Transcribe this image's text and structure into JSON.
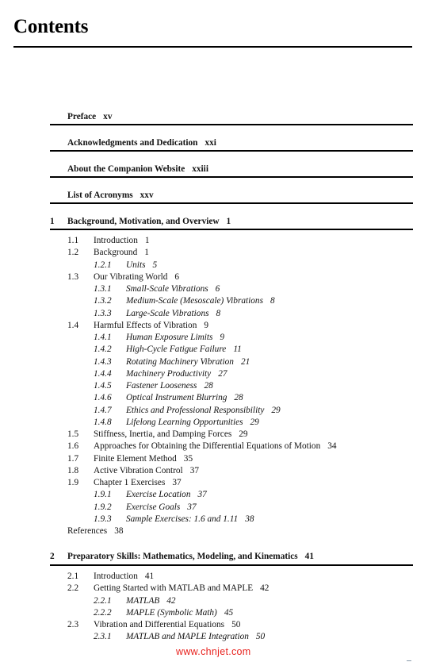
{
  "page": {
    "title": "Contents",
    "watermark": "www.chnjet.com"
  },
  "front_matter": [
    {
      "title": "Preface",
      "page": "xv"
    },
    {
      "title": "Acknowledgments and Dedication",
      "page": "xxi"
    },
    {
      "title": "About the Companion Website",
      "page": "xxiii"
    },
    {
      "title": "List of Acronyms",
      "page": "xxv"
    }
  ],
  "chapters": [
    {
      "number": "1",
      "title": "Background, Motivation, and Overview",
      "page": "1",
      "sections": [
        {
          "number": "1.1",
          "title": "Introduction",
          "page": "1"
        },
        {
          "number": "1.2",
          "title": "Background",
          "page": "1"
        },
        {
          "number": "1.2.1",
          "title": "Units",
          "page": "5",
          "sub": true
        },
        {
          "number": "1.3",
          "title": "Our Vibrating World",
          "page": "6"
        },
        {
          "number": "1.3.1",
          "title": "Small-Scale Vibrations",
          "page": "6",
          "sub": true
        },
        {
          "number": "1.3.2",
          "title": "Medium-Scale (Mesoscale) Vibrations",
          "page": "8",
          "sub": true
        },
        {
          "number": "1.3.3",
          "title": "Large-Scale Vibrations",
          "page": "8",
          "sub": true
        },
        {
          "number": "1.4",
          "title": "Harmful Effects of Vibration",
          "page": "9"
        },
        {
          "number": "1.4.1",
          "title": "Human Exposure Limits",
          "page": "9",
          "sub": true
        },
        {
          "number": "1.4.2",
          "title": "High-Cycle Fatigue Failure",
          "page": "11",
          "sub": true
        },
        {
          "number": "1.4.3",
          "title": "Rotating Machinery Vibration",
          "page": "21",
          "sub": true
        },
        {
          "number": "1.4.4",
          "title": "Machinery Productivity",
          "page": "27",
          "sub": true
        },
        {
          "number": "1.4.5",
          "title": "Fastener Looseness",
          "page": "28",
          "sub": true
        },
        {
          "number": "1.4.6",
          "title": "Optical Instrument Blurring",
          "page": "28",
          "sub": true
        },
        {
          "number": "1.4.7",
          "title": "Ethics and Professional Responsibility",
          "page": "29",
          "sub": true
        },
        {
          "number": "1.4.8",
          "title": "Lifelong Learning Opportunities",
          "page": "29",
          "sub": true
        },
        {
          "number": "1.5",
          "title": "Stiffness, Inertia, and Damping Forces",
          "page": "29"
        },
        {
          "number": "1.6",
          "title": "Approaches for Obtaining the Differential Equations of Motion",
          "page": "34"
        },
        {
          "number": "1.7",
          "title": "Finite Element Method",
          "page": "35"
        },
        {
          "number": "1.8",
          "title": "Active Vibration Control",
          "page": "37"
        },
        {
          "number": "1.9",
          "title": "Chapter 1 Exercises",
          "page": "37"
        },
        {
          "number": "1.9.1",
          "title": "Exercise Location",
          "page": "37",
          "sub": true
        },
        {
          "number": "1.9.2",
          "title": "Exercise Goals",
          "page": "37",
          "sub": true
        },
        {
          "number": "1.9.3",
          "title": "Sample Exercises: 1.6 and 1.11",
          "page": "38",
          "sub": true
        }
      ],
      "references": {
        "title": "References",
        "page": "38"
      }
    },
    {
      "number": "2",
      "title": "Preparatory Skills: Mathematics, Modeling, and Kinematics",
      "page": "41",
      "sections": [
        {
          "number": "2.1",
          "title": "Introduction",
          "page": "41"
        },
        {
          "number": "2.2",
          "title": "Getting Started with MATLAB and MAPLE",
          "page": "42"
        },
        {
          "number": "2.2.1",
          "title": "MATLAB",
          "page": "42",
          "sub": true
        },
        {
          "number": "2.2.2",
          "title": "MAPLE (Symbolic Math)",
          "page": "45",
          "sub": true
        },
        {
          "number": "2.3",
          "title": "Vibration and Differential Equations",
          "page": "50"
        },
        {
          "number": "2.3.1",
          "title": "MATLAB and MAPLE Integration",
          "page": "50",
          "sub": true
        }
      ]
    }
  ]
}
